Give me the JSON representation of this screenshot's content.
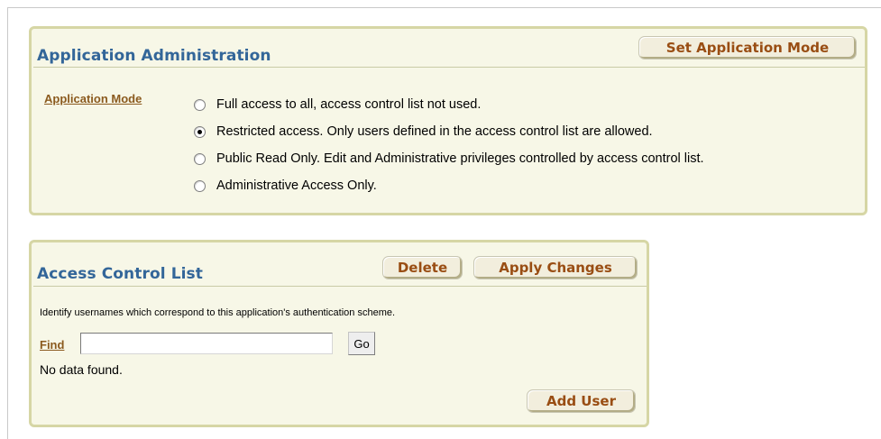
{
  "app_admin": {
    "title": "Application Administration",
    "set_mode_button": "Set Application Mode",
    "mode_label": "Application Mode",
    "modes": [
      {
        "label": "Full access to all, access control list not used.",
        "checked": false
      },
      {
        "label": "Restricted access. Only users defined in the access control list are allowed.",
        "checked": true
      },
      {
        "label": "Public Read Only. Edit and Administrative privileges controlled by access control list.",
        "checked": false
      },
      {
        "label": "Administrative Access Only.",
        "checked": false
      }
    ]
  },
  "acl": {
    "title": "Access Control List",
    "delete_button": "Delete",
    "apply_button": "Apply Changes",
    "instructions": "Identify usernames which correspond to this application's authentication scheme.",
    "find_label": "Find",
    "find_value": "",
    "go_button": "Go",
    "no_data": "No data found.",
    "add_user_button": "Add User"
  },
  "colors": {
    "region_bg": "#f7f7e7",
    "region_border": "#d6d6a5",
    "title": "#336699",
    "button_text": "#994d13",
    "link": "#8b5a1e"
  }
}
